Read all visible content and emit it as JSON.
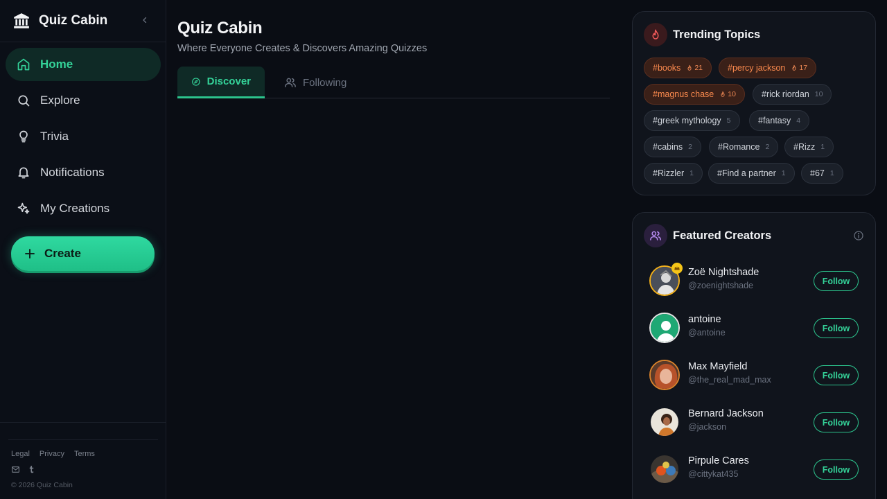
{
  "app": {
    "name": "Quiz Cabin"
  },
  "sidebar": {
    "items": [
      {
        "label": "Home",
        "icon": "home-icon"
      },
      {
        "label": "Explore",
        "icon": "search-icon"
      },
      {
        "label": "Trivia",
        "icon": "lightbulb-icon"
      },
      {
        "label": "Notifications",
        "icon": "bell-icon"
      },
      {
        "label": "My Creations",
        "icon": "sparkles-icon"
      }
    ],
    "active_item": "Home",
    "create_label": "Create",
    "footer": {
      "links": [
        "Legal",
        "Privacy",
        "Terms"
      ],
      "icons": [
        "mail-icon",
        "tumblr-icon"
      ],
      "copyright": "© 2026 Quiz Cabin"
    }
  },
  "main": {
    "title": "Quiz Cabin",
    "subtitle": "Where Everyone Creates & Discovers Amazing Quizzes",
    "tabs": [
      {
        "label": "Discover",
        "icon": "compass-icon",
        "active": true
      },
      {
        "label": "Following",
        "icon": "users-icon",
        "active": false
      }
    ]
  },
  "trending": {
    "title": "Trending Topics",
    "icon": "flame-icon",
    "tags": [
      {
        "label": "#books",
        "count": "21",
        "hot": true
      },
      {
        "label": "#percy jackson",
        "count": "17",
        "hot": true
      },
      {
        "label": "#magnus chase",
        "count": "10",
        "hot": true
      },
      {
        "label": "#rick riordan",
        "count": "10",
        "hot": false
      },
      {
        "label": "#greek mythology",
        "count": "5",
        "hot": false
      },
      {
        "label": "#fantasy",
        "count": "4",
        "hot": false
      },
      {
        "label": "#cabins",
        "count": "2",
        "hot": false
      },
      {
        "label": "#Romance",
        "count": "2",
        "hot": false
      },
      {
        "label": "#Rizz",
        "count": "1",
        "hot": false
      },
      {
        "label": "#Rizzler",
        "count": "1",
        "hot": false
      },
      {
        "label": "#Find a partner",
        "count": "1",
        "hot": false
      },
      {
        "label": "#67",
        "count": "1",
        "hot": false
      }
    ]
  },
  "featured": {
    "title": "Featured Creators",
    "icon": "users-icon",
    "follow_label": "Follow",
    "creators": [
      {
        "name": "Zoë Nightshade",
        "handle": "@zoenightshade",
        "badge": "crown-icon"
      },
      {
        "name": "antoine",
        "handle": "@antoine"
      },
      {
        "name": "Max Mayfield",
        "handle": "@the_real_mad_max"
      },
      {
        "name": "Bernard Jackson",
        "handle": "@jackson"
      },
      {
        "name": "Pirpule Cares",
        "handle": "@cittykat435"
      }
    ]
  },
  "colors": {
    "background": "#0a0d14",
    "accent": "#34d399",
    "hot_tag": "#fb8a4e",
    "crown": "#f5c518"
  }
}
